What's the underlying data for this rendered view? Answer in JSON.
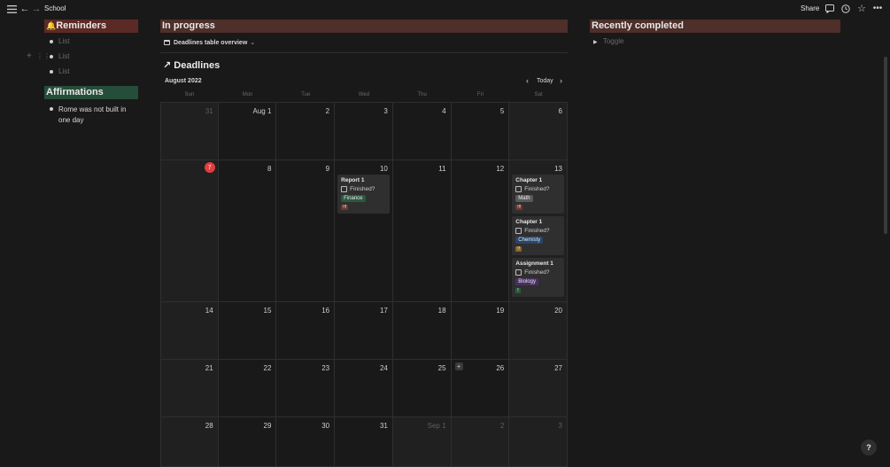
{
  "topbar": {
    "breadcrumb": "School",
    "share_label": "Share",
    "icons": [
      "menu-icon",
      "back-arrow-icon",
      "forward-arrow-icon",
      "comment-icon",
      "history-icon",
      "star-icon",
      "more-icon"
    ]
  },
  "reminders": {
    "title": "Reminders",
    "emoji": "🔔",
    "items": [
      "List",
      "List",
      "List"
    ],
    "color": "#5c2a25"
  },
  "affirmations": {
    "title": "Affirmations",
    "items": [
      "Rome was not built in one day"
    ],
    "color": "#264d3a"
  },
  "in_progress": {
    "title": "In progress",
    "color": "#4e2f29",
    "view_label": "Deadlines table overview",
    "db_title": "Deadlines",
    "month_label": "August 2022",
    "today_label": "Today",
    "weekdays": [
      "Sun",
      "Mon",
      "Tue",
      "Wed",
      "Thu",
      "Fri",
      "Sat"
    ],
    "weeks": [
      [
        "31",
        "Aug 1",
        "2",
        "3",
        "4",
        "5",
        "6"
      ],
      [
        "7",
        "8",
        "9",
        "10",
        "11",
        "12",
        "13"
      ],
      [
        "14",
        "15",
        "16",
        "17",
        "18",
        "19",
        "20"
      ],
      [
        "21",
        "22",
        "23",
        "24",
        "25",
        "26",
        "27"
      ],
      [
        "28",
        "29",
        "30",
        "31",
        "Sep 1",
        "2",
        "3"
      ]
    ],
    "cards": [
      {
        "title": "Report 1",
        "check_label": "Finished?",
        "tag": "Finance",
        "tag_color": "#2b593f",
        "prio": "!!!",
        "prio_color": "#6e3630"
      },
      {
        "title": "Chapter 1",
        "check_label": "Finished?",
        "tag": "Math",
        "tag_color": "#5a5a5a",
        "prio": "!!!",
        "prio_color": "#6e3630"
      },
      {
        "title": "Chapter 1",
        "check_label": "Finished?",
        "tag": "Chemisty",
        "tag_color": "#28456c",
        "prio": "!!",
        "prio_color": "#89632a"
      },
      {
        "title": "Assignment 1",
        "check_label": "Finished?",
        "tag": "Biology",
        "tag_color": "#492f64",
        "prio": "!",
        "prio_color": "#2b593f"
      }
    ]
  },
  "recently_completed": {
    "title": "Recently completed",
    "color": "#4e2f29",
    "toggle_placeholder": "Toggle"
  },
  "help_label": "?"
}
